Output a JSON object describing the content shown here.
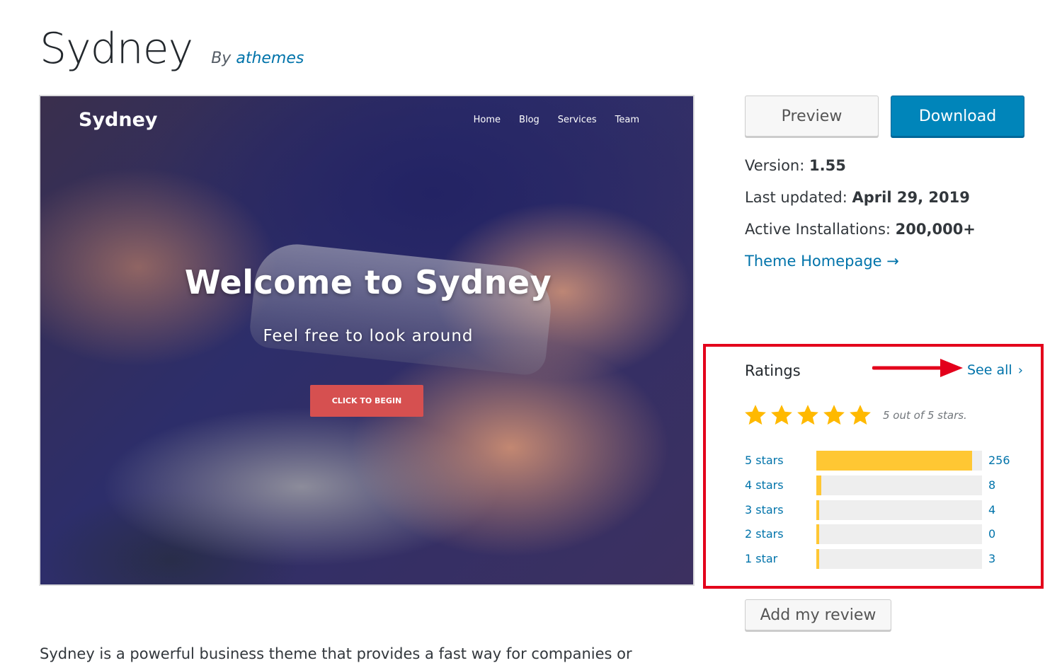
{
  "header": {
    "theme_name": "Sydney",
    "by_label": "By",
    "author": "athemes"
  },
  "screenshot": {
    "brand": "Sydney",
    "nav": [
      "Home",
      "Blog",
      "Services",
      "Team"
    ],
    "heading": "Welcome to Sydney",
    "subheading": "Feel free to look around",
    "cta": "CLICK TO BEGIN"
  },
  "actions": {
    "preview_label": "Preview",
    "download_label": "Download"
  },
  "meta": {
    "version_label": "Version:",
    "version_value": "1.55",
    "updated_label": "Last updated:",
    "updated_value": "April 29, 2019",
    "installs_label": "Active Installations:",
    "installs_value": "200,000+",
    "homepage_link": "Theme Homepage →"
  },
  "ratings": {
    "title": "Ratings",
    "see_all": "See all",
    "see_all_chevron": "›",
    "average": 5,
    "stars_caption": "5 out of 5 stars.",
    "rows": [
      {
        "label": "5 stars",
        "count": "256",
        "fraction": 0.94
      },
      {
        "label": "4 stars",
        "count": "8",
        "fraction": 0.03
      },
      {
        "label": "3 stars",
        "count": "4",
        "fraction": 0.015
      },
      {
        "label": "2 stars",
        "count": "0",
        "fraction": 0.0
      },
      {
        "label": "1 star",
        "count": "3",
        "fraction": 0.01
      }
    ]
  },
  "review": {
    "add_review_label": "Add my review"
  },
  "description": {
    "text": "Sydney is a powerful business theme that provides a fast way for companies or"
  },
  "colors": {
    "link": "#0073aa",
    "primary_button": "#0085ba",
    "star": "#ffb900",
    "bar_fill": "#ffc733",
    "highlight_frame": "#e3001b"
  }
}
